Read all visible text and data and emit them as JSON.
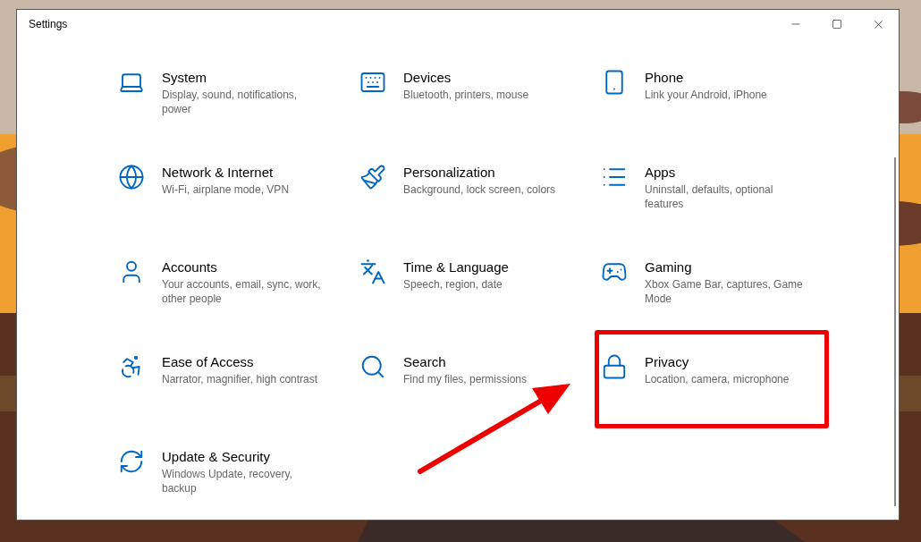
{
  "window": {
    "title": "Settings"
  },
  "categories": [
    {
      "title": "System",
      "description": "Display, sound, notifications, power",
      "highlighted": false
    },
    {
      "title": "Devices",
      "description": "Bluetooth, printers, mouse",
      "highlighted": false
    },
    {
      "title": "Phone",
      "description": "Link your Android, iPhone",
      "highlighted": false
    },
    {
      "title": "Network & Internet",
      "description": "Wi-Fi, airplane mode, VPN",
      "highlighted": false
    },
    {
      "title": "Personalization",
      "description": "Background, lock screen, colors",
      "highlighted": false
    },
    {
      "title": "Apps",
      "description": "Uninstall, defaults, optional features",
      "highlighted": false
    },
    {
      "title": "Accounts",
      "description": "Your accounts, email, sync, work, other people",
      "highlighted": false
    },
    {
      "title": "Time & Language",
      "description": "Speech, region, date",
      "highlighted": false
    },
    {
      "title": "Gaming",
      "description": "Xbox Game Bar, captures, Game Mode",
      "highlighted": false
    },
    {
      "title": "Ease of Access",
      "description": "Narrator, magnifier, high contrast",
      "highlighted": false
    },
    {
      "title": "Search",
      "description": "Find my files, permissions",
      "highlighted": false
    },
    {
      "title": "Privacy",
      "description": "Location, camera, microphone",
      "highlighted": true
    },
    {
      "title": "Update & Security",
      "description": "Windows Update, recovery, backup",
      "highlighted": false
    }
  ]
}
